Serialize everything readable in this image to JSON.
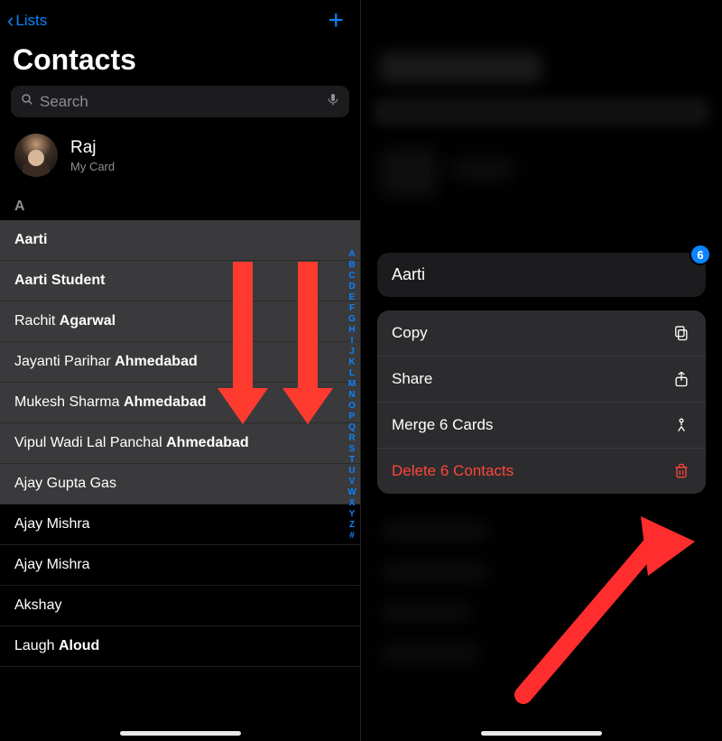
{
  "left": {
    "back_label": "Lists",
    "title": "Contacts",
    "search_placeholder": "Search",
    "mycard": {
      "name": "Raj",
      "sub": "My Card"
    },
    "section_letter": "A",
    "rows": [
      {
        "first": "",
        "last": "Aarti",
        "selected": true
      },
      {
        "first": "",
        "last": "Aarti Student",
        "selected": true
      },
      {
        "first": "Rachit ",
        "last": "Agarwal",
        "selected": true
      },
      {
        "first": "Jayanti Parihar ",
        "last": "Ahmedabad",
        "selected": true
      },
      {
        "first": "Mukesh Sharma ",
        "last": "Ahmedabad",
        "selected": true
      },
      {
        "first": "Vipul Wadi Lal Panchal ",
        "last": "Ahmedabad",
        "selected": true
      },
      {
        "first": "Ajay Gupta Gas",
        "last": "",
        "selected": true
      },
      {
        "first": "Ajay Mishra",
        "last": "",
        "selected": false
      },
      {
        "first": "Ajay Mishra",
        "last": "",
        "selected": false
      },
      {
        "first": "Akshay",
        "last": "",
        "selected": false
      },
      {
        "first": "Laugh ",
        "last": "Aloud",
        "selected": false
      }
    ],
    "index_letters": [
      "A",
      "B",
      "C",
      "D",
      "E",
      "F",
      "G",
      "H",
      "I",
      "J",
      "K",
      "L",
      "M",
      "N",
      "O",
      "P",
      "Q",
      "R",
      "S",
      "T",
      "U",
      "V",
      "W",
      "X",
      "Y",
      "Z",
      "#"
    ]
  },
  "right": {
    "selected_name": "Aarti",
    "badge_count": "6",
    "menu": {
      "copy": "Copy",
      "share": "Share",
      "merge": "Merge 6 Cards",
      "delete": "Delete 6 Contacts"
    }
  }
}
